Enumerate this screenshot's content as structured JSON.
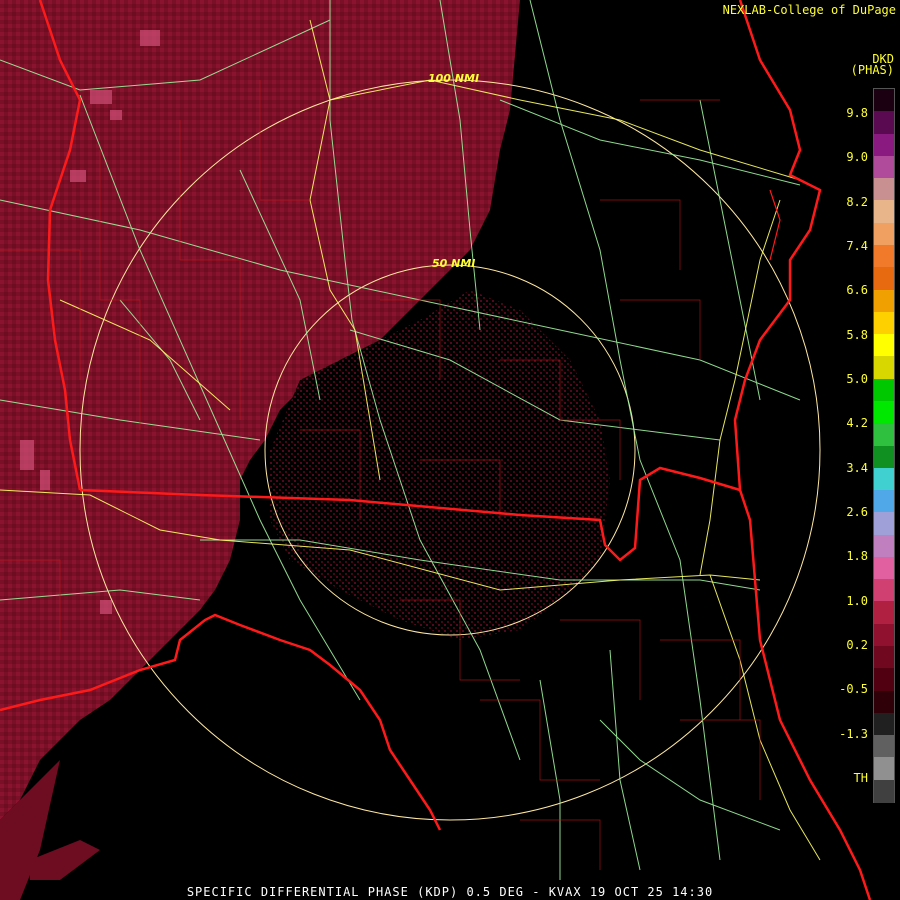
{
  "credit": "NEXLAB-College of DuPage",
  "product_title": "SPECIFIC DIFFERENTIAL PHASE (KDP) 0.5 DEG - KVAX 19 OCT 25 14:30",
  "units": {
    "line1": "DKD",
    "line2": "(PHAS)"
  },
  "range_rings": [
    {
      "label": "100 NMI"
    },
    {
      "label": "50 NMI"
    }
  ],
  "color_scale": {
    "ticks": [
      "9.8",
      "9.0",
      "8.2",
      "7.4",
      "6.6",
      "5.8",
      "5.0",
      "4.2",
      "3.4",
      "2.6",
      "1.8",
      "1.0",
      "0.2",
      "-0.5",
      "-1.3",
      "TH"
    ],
    "colors": [
      "#1a0010",
      "#5a0a50",
      "#8a1a80",
      "#b04a9a",
      "#c89090",
      "#e8b48a",
      "#f0a060",
      "#f07a2a",
      "#e86a10",
      "#f0a000",
      "#ffd000",
      "#ffff00",
      "#d8d800",
      "#00c800",
      "#00e800",
      "#30c040",
      "#109020",
      "#40d0d0",
      "#50a8e8",
      "#a0a0d8",
      "#c080c0",
      "#e060a0",
      "#d04070",
      "#b02040",
      "#901030",
      "#700820",
      "#500010",
      "#300008",
      "#202020",
      "#606060",
      "#909090",
      "#404040"
    ]
  },
  "colors": {
    "state_border": "#ff1a1a",
    "county_border": "#c81414",
    "highway": "#9ef09e",
    "interstate": "#ffff66",
    "ring": "#ffe8a0",
    "echo": "#7a1028"
  }
}
